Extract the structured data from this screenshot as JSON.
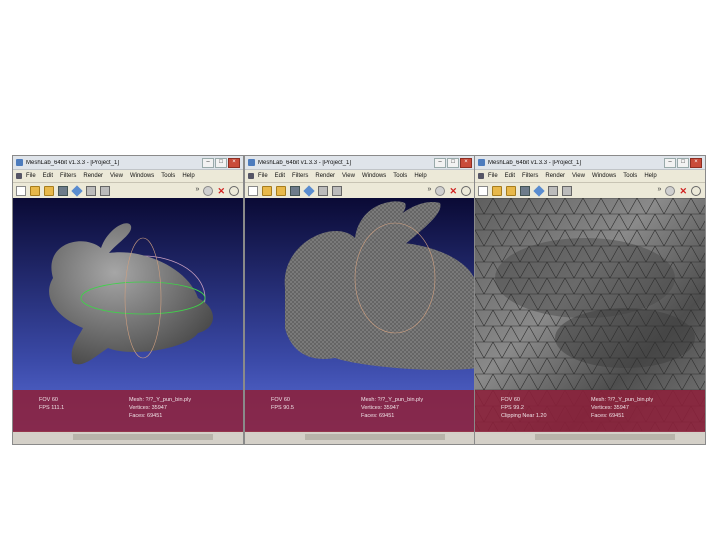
{
  "windows": [
    {
      "title": "MeshLab_64bit v1.3.3 - [Project_1]",
      "menu": [
        "File",
        "Edit",
        "Filters",
        "Render",
        "View",
        "Windows",
        "Tools",
        "Help"
      ],
      "info_left": [
        "FOV  60",
        "FPS  111.1"
      ],
      "info_right": [
        "Mesh: ?/?_Y_pun_bin.ply",
        "Vertices: 35947",
        "Faces: 69451"
      ]
    },
    {
      "title": "MeshLab_64bit v1.3.3 - [Project_1]",
      "menu": [
        "File",
        "Edit",
        "Filters",
        "Render",
        "View",
        "Windows",
        "Tools",
        "Help"
      ],
      "info_left": [
        "FOV  60",
        "FPS  90.5"
      ],
      "info_right": [
        "Mesh: ?/?_Y_pun_bin.ply",
        "Vertices: 35947",
        "Faces: 69451"
      ]
    },
    {
      "title": "MeshLab_64bit v1.3.3 - [Project_1]",
      "menu": [
        "File",
        "Edit",
        "Filters",
        "Render",
        "View",
        "Windows",
        "Tools",
        "Help"
      ],
      "info_left": [
        "FOV  60",
        "FPS  99.2",
        "Clipping Near  1.20"
      ],
      "info_right": [
        "Mesh: ?/?_Y_pun_bin.ply",
        "Vertices: 35947",
        "Faces: 69451"
      ]
    }
  ],
  "window_buttons": {
    "minimize": "–",
    "maximize": "□",
    "close": "×"
  }
}
